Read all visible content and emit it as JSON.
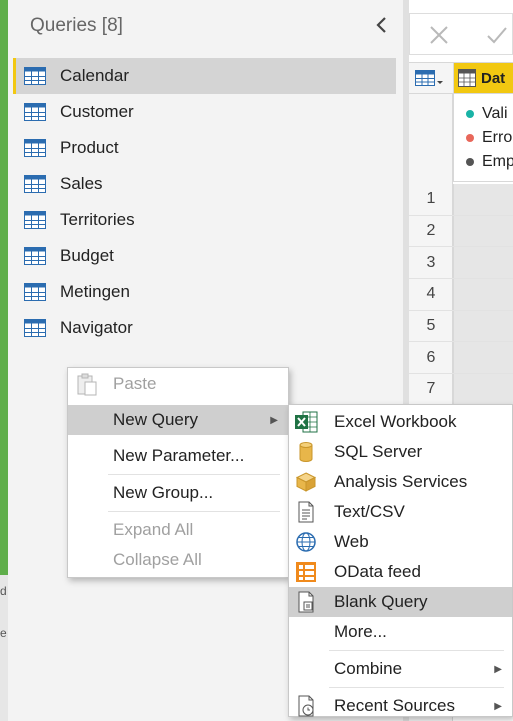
{
  "queries_pane": {
    "title": "Queries [8]",
    "items": [
      {
        "label": "Calendar",
        "selected": true
      },
      {
        "label": "Customer"
      },
      {
        "label": "Product"
      },
      {
        "label": "Sales"
      },
      {
        "label": "Territories"
      },
      {
        "label": "Budget"
      },
      {
        "label": "Metingen"
      },
      {
        "label": "Navigator"
      }
    ]
  },
  "grid": {
    "column_header": "Dat",
    "quality": [
      {
        "label": "Vali",
        "color": "#19b3a6"
      },
      {
        "label": "Erro",
        "color": "#e8675a"
      },
      {
        "label": "Emp",
        "color": "#555555"
      }
    ],
    "row_numbers": [
      "1",
      "2",
      "3",
      "4",
      "5",
      "6",
      "7"
    ]
  },
  "left_strip": {
    "letter_1": "d",
    "letter_2": "e"
  },
  "context_menu": {
    "paste": "Paste",
    "new_query": "New Query",
    "new_parameter": "New Parameter...",
    "new_group": "New Group...",
    "expand_all": "Expand All",
    "collapse_all": "Collapse All"
  },
  "new_query_submenu": {
    "items": [
      {
        "label": "Excel Workbook",
        "icon": "excel-icon"
      },
      {
        "label": "SQL Server",
        "icon": "database-icon"
      },
      {
        "label": "Analysis Services",
        "icon": "cube-icon"
      },
      {
        "label": "Text/CSV",
        "icon": "text-file-icon"
      },
      {
        "label": "Web",
        "icon": "globe-icon"
      },
      {
        "label": "OData feed",
        "icon": "odata-icon"
      },
      {
        "label": "Blank Query",
        "icon": "blank-query-icon"
      },
      {
        "label": "More..."
      },
      {
        "label": "Combine"
      },
      {
        "label": "Recent Sources",
        "icon": "recent-sources-icon"
      }
    ]
  },
  "colors": {
    "accent": "#f2c811",
    "excel": "#1f7244",
    "hover": "#cfcfcf"
  }
}
